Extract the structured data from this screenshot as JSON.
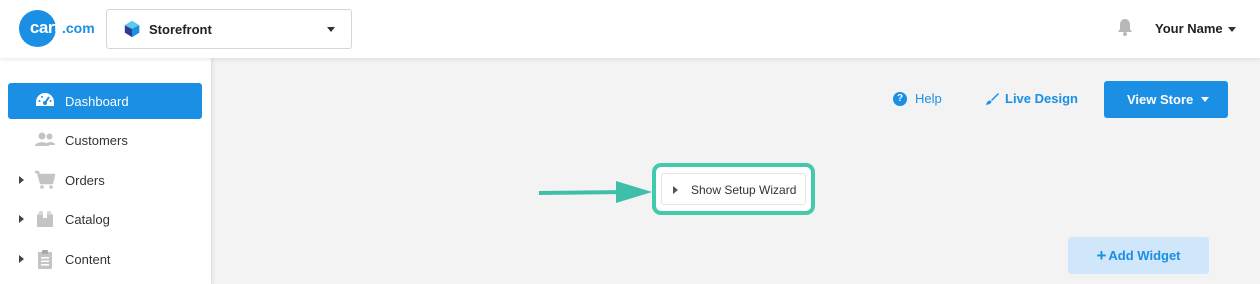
{
  "header": {
    "logo_text": "cart",
    "logo_suffix": ".com",
    "store_selector": {
      "selected": "Storefront"
    },
    "user_name": "Your Name"
  },
  "sidebar": {
    "items": [
      {
        "label": "Dashboard",
        "icon": "dashboard-gauge-icon",
        "active": true,
        "expandable": false
      },
      {
        "label": "Customers",
        "icon": "users-icon",
        "active": false,
        "expandable": false
      },
      {
        "label": "Orders",
        "icon": "cart-icon",
        "active": false,
        "expandable": true
      },
      {
        "label": "Catalog",
        "icon": "box-icon",
        "active": false,
        "expandable": true
      },
      {
        "label": "Content",
        "icon": "clipboard-icon",
        "active": false,
        "expandable": true
      }
    ]
  },
  "toolbar": {
    "help_label": "Help",
    "live_design_label": "Live Design",
    "view_store_label": "View Store"
  },
  "main": {
    "setup_wizard_label": "Show Setup Wizard",
    "add_widget_label": "Add Widget",
    "add_widget_prefix": "+"
  },
  "colors": {
    "accent": "#1a8fe3",
    "highlight": "#44c9ad",
    "add_widget_bg": "#cfe6fb",
    "page_bg": "#f3f3f3"
  }
}
